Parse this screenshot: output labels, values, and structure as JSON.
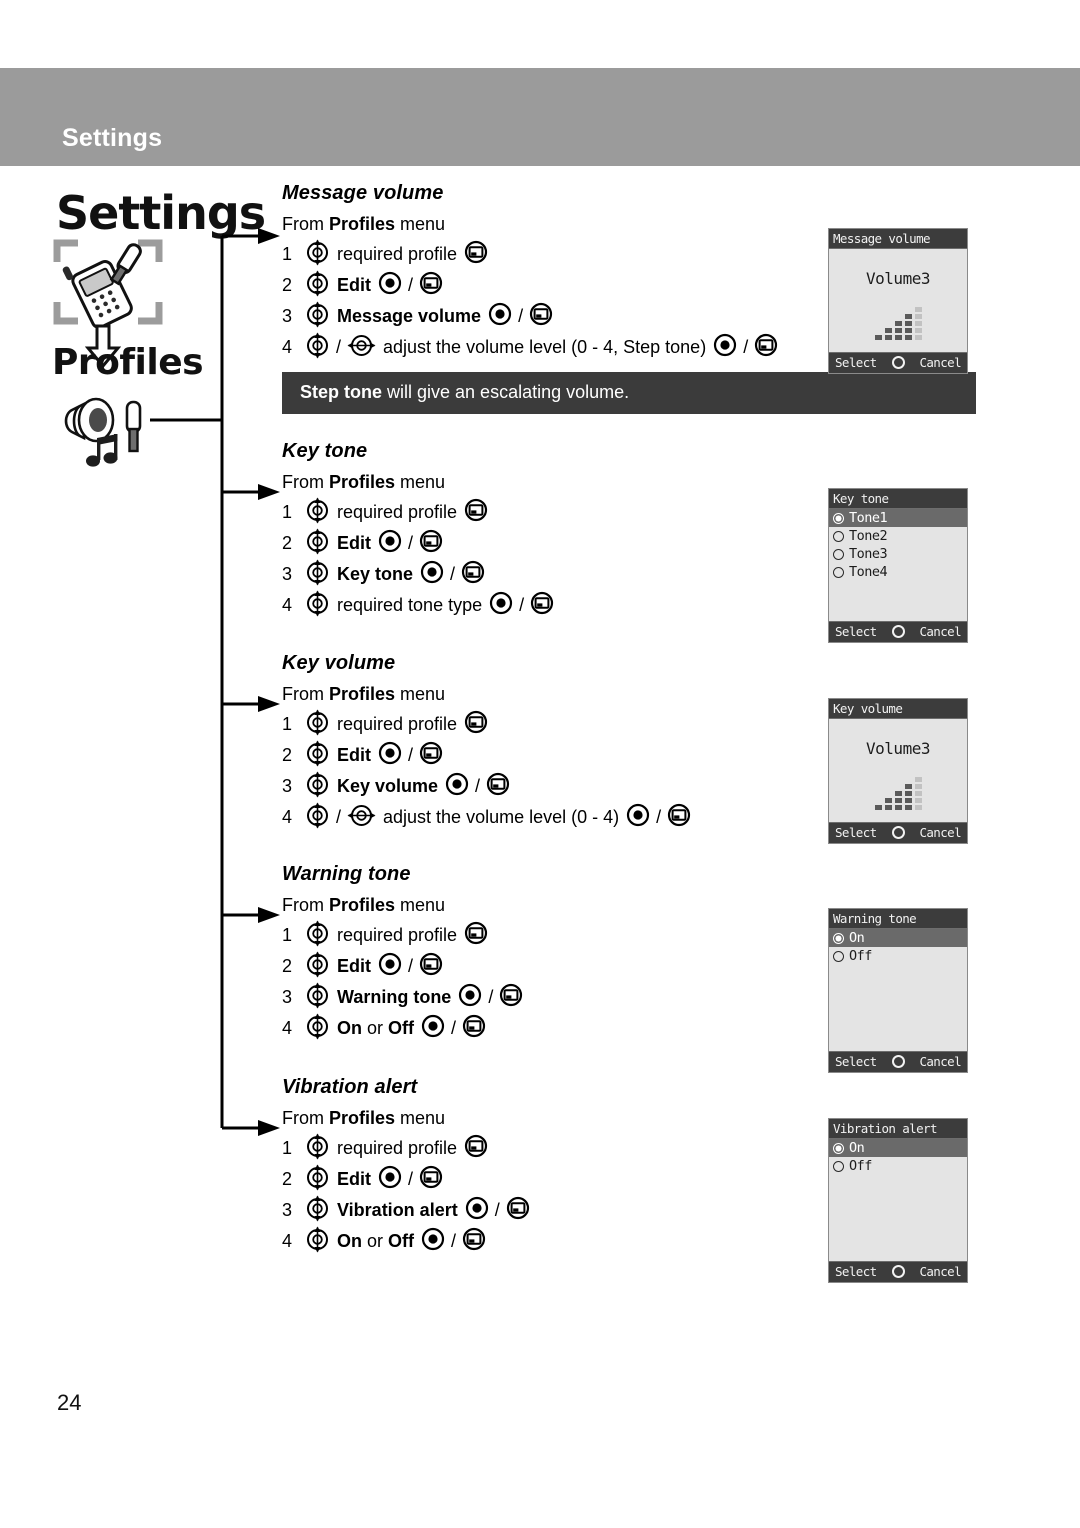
{
  "header": {
    "title": "Settings"
  },
  "sidebar": {
    "chapter": "Settings",
    "section": "Profiles",
    "phone_tool_icon": "phone-settings-icon",
    "arrow_icon": "down-arrow-icon",
    "profiles_icon": "speaker-music-screwdriver-icon"
  },
  "page_number": "24",
  "colors": {
    "header_band": "#9b9b9b",
    "note_bar": "#3b3b3b",
    "screen_title_bar": "#3c3c3c",
    "screen_body": "#e4e4e4",
    "screen_highlight": "#6a6a6a"
  },
  "labels": {
    "from_prefix": "From ",
    "from_bold": "Profiles",
    "from_suffix": " menu",
    "slash": "/",
    "or": " or "
  },
  "sections": [
    {
      "heading": "Message volume",
      "steps": [
        {
          "num": "1",
          "icons": [
            "nav-updown"
          ],
          "text": "required profile",
          "after": [
            "softkey"
          ]
        },
        {
          "num": "2",
          "icons": [
            "nav-updown"
          ],
          "bold": "Edit",
          "after": [
            "select",
            "slash",
            "softkey"
          ]
        },
        {
          "num": "3",
          "icons": [
            "nav-updown"
          ],
          "bold": "Message volume",
          "after": [
            "select",
            "slash",
            "softkey"
          ]
        },
        {
          "num": "4",
          "icons": [
            "nav-updown",
            "slash",
            "nav-leftright"
          ],
          "text": "adjust the volume level (0 - 4, Step tone)",
          "after": [
            "select",
            "slash",
            "softkey"
          ]
        }
      ],
      "note": {
        "bold": "Step tone",
        "text": " will give an escalating volume."
      },
      "screen": {
        "type": "volume",
        "title": "Message volume",
        "value_label": "Volume3",
        "bars_filled": 4,
        "bars_total": 5,
        "softkey_left": "Select",
        "softkey_right": "Cancel",
        "center_key": "ok-dot"
      }
    },
    {
      "heading": "Key tone",
      "steps": [
        {
          "num": "1",
          "icons": [
            "nav-updown"
          ],
          "text": "required profile",
          "after": [
            "softkey"
          ]
        },
        {
          "num": "2",
          "icons": [
            "nav-updown"
          ],
          "bold": "Edit",
          "after": [
            "select",
            "slash",
            "softkey"
          ]
        },
        {
          "num": "3",
          "icons": [
            "nav-updown"
          ],
          "bold": "Key tone",
          "after": [
            "select",
            "slash",
            "softkey"
          ]
        },
        {
          "num": "4",
          "icons": [
            "nav-updown"
          ],
          "text": "required tone type",
          "after": [
            "select",
            "slash",
            "softkey"
          ]
        }
      ],
      "note": null,
      "screen": {
        "type": "list",
        "title": "Key tone",
        "options": [
          {
            "label": "Tone1",
            "selected": true
          },
          {
            "label": "Tone2",
            "selected": false
          },
          {
            "label": "Tone3",
            "selected": false
          },
          {
            "label": "Tone4",
            "selected": false
          }
        ],
        "softkey_left": "Select",
        "softkey_right": "Cancel",
        "center_key": "ok-dot"
      }
    },
    {
      "heading": "Key volume",
      "steps": [
        {
          "num": "1",
          "icons": [
            "nav-updown"
          ],
          "text": "required profile",
          "after": [
            "softkey"
          ]
        },
        {
          "num": "2",
          "icons": [
            "nav-updown"
          ],
          "bold": "Edit",
          "after": [
            "select",
            "slash",
            "softkey"
          ]
        },
        {
          "num": "3",
          "icons": [
            "nav-updown"
          ],
          "bold": "Key volume",
          "after": [
            "select",
            "slash",
            "softkey"
          ]
        },
        {
          "num": "4",
          "icons": [
            "nav-updown",
            "slash",
            "nav-leftright"
          ],
          "text": "adjust the volume level (0 - 4)",
          "after": [
            "select",
            "slash",
            "softkey"
          ]
        }
      ],
      "note": null,
      "screen": {
        "type": "volume",
        "title": "Key volume",
        "value_label": "Volume3",
        "bars_filled": 4,
        "bars_total": 5,
        "softkey_left": "Select",
        "softkey_right": "Cancel",
        "center_key": "ok-dot"
      }
    },
    {
      "heading": "Warning tone",
      "steps": [
        {
          "num": "1",
          "icons": [
            "nav-updown"
          ],
          "text": "required profile",
          "after": [
            "softkey"
          ]
        },
        {
          "num": "2",
          "icons": [
            "nav-updown"
          ],
          "bold": "Edit",
          "after": [
            "select",
            "slash",
            "softkey"
          ]
        },
        {
          "num": "3",
          "icons": [
            "nav-updown"
          ],
          "bold": "Warning tone",
          "after": [
            "select",
            "slash",
            "softkey"
          ]
        },
        {
          "num": "4",
          "icons": [
            "nav-updown"
          ],
          "bold": "On",
          "bold2": "Off",
          "joiner": " or ",
          "after": [
            "select",
            "slash",
            "softkey"
          ]
        }
      ],
      "note": null,
      "screen": {
        "type": "list",
        "title": "Warning tone",
        "options": [
          {
            "label": "On",
            "selected": true
          },
          {
            "label": "Off",
            "selected": false
          }
        ],
        "softkey_left": "Select",
        "softkey_right": "Cancel",
        "center_key": "ok-dot"
      }
    },
    {
      "heading": "Vibration alert",
      "steps": [
        {
          "num": "1",
          "icons": [
            "nav-updown"
          ],
          "text": "required profile",
          "after": [
            "softkey"
          ]
        },
        {
          "num": "2",
          "icons": [
            "nav-updown"
          ],
          "bold": "Edit",
          "after": [
            "select",
            "slash",
            "softkey"
          ]
        },
        {
          "num": "3",
          "icons": [
            "nav-updown"
          ],
          "bold": "Vibration alert",
          "after": [
            "select",
            "slash",
            "softkey"
          ]
        },
        {
          "num": "4",
          "icons": [
            "nav-updown"
          ],
          "bold": "On",
          "bold2": "Off",
          "joiner": " or ",
          "after": [
            "select",
            "slash",
            "softkey"
          ]
        }
      ],
      "note": null,
      "screen": {
        "type": "list",
        "title": "Vibration alert",
        "options": [
          {
            "label": "On",
            "selected": true
          },
          {
            "label": "Off",
            "selected": false
          }
        ],
        "softkey_left": "Select",
        "softkey_right": "Cancel",
        "center_key": "ok-dot"
      }
    }
  ]
}
